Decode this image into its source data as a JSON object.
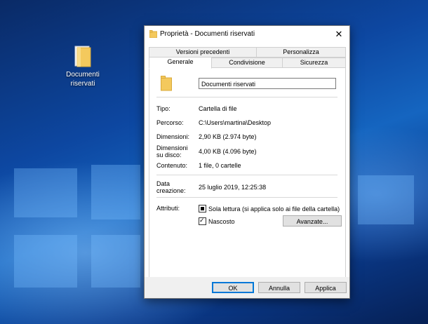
{
  "desktop": {
    "icon_label_line1": "Documenti",
    "icon_label_line2": "riservati"
  },
  "dialog": {
    "title": "Proprietà - Documenti riservati",
    "tabs_row1": [
      "Versioni precedenti",
      "Personalizza"
    ],
    "tabs_row2": [
      "Generale",
      "Condivisione",
      "Sicurezza"
    ],
    "active_tab": "Generale",
    "name_value": "Documenti riservati",
    "fields": {
      "tipo_label": "Tipo:",
      "tipo_value": "Cartella di file",
      "percorso_label": "Percorso:",
      "percorso_value": "C:\\Users\\martina\\Desktop",
      "dimensioni_label": "Dimensioni:",
      "dimensioni_value": "2,90 KB (2.974 byte)",
      "disco_label_1": "Dimensioni",
      "disco_label_2": "su disco:",
      "disco_value": "4,00 KB (4.096 byte)",
      "contenuto_label": "Contenuto:",
      "contenuto_value": "1 file, 0 cartelle",
      "data_label_1": "Data",
      "data_label_2": "creazione:",
      "data_value": "25 luglio 2019, 12:25:38"
    },
    "attributes": {
      "label": "Attributi:",
      "readonly_label": "Sola lettura (si applica solo ai file della cartella)",
      "hidden_label": "Nascosto",
      "advanced_button": "Avanzate..."
    },
    "buttons": {
      "ok": "OK",
      "cancel": "Annulla",
      "apply": "Applica"
    },
    "colors": {
      "accent": "#0078d7",
      "folder": "#f4c95d"
    }
  }
}
